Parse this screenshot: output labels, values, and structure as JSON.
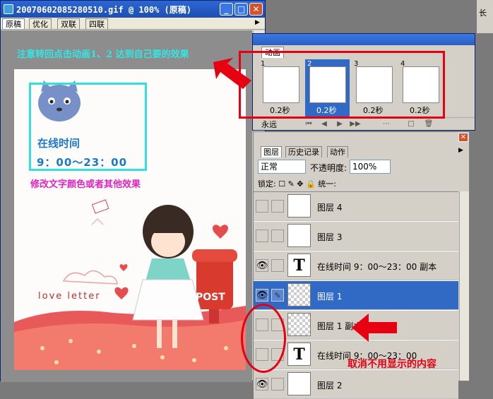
{
  "doc_window": {
    "title": "20070602085280510.gif @ 100% (原稿)",
    "tabs": [
      "原稿",
      "优化",
      "双联",
      "四联"
    ],
    "active_tab": 0
  },
  "image": {
    "online_label": "在线时间",
    "hours": "9：00～23：00",
    "love_letter": "love letter",
    "post": "POST"
  },
  "annotations": {
    "top_note": "注意转回点击动画1、2 达到自己要的效果",
    "modify_note": "修改文字颜色或者其他效果",
    "cancel_note": "取消不用显示的内容",
    "accent_color": "#e60012"
  },
  "animation_panel": {
    "tab": "动画",
    "frames": [
      {
        "num": "1",
        "delay": "0.2秒"
      },
      {
        "num": "2",
        "delay": "0.2秒"
      },
      {
        "num": "3",
        "delay": "0.2秒"
      },
      {
        "num": "4",
        "delay": "0.2秒"
      }
    ],
    "selected_frame": 2,
    "loop": "永远"
  },
  "layers_panel": {
    "tabs": [
      "图层",
      "历史记录",
      "动作"
    ],
    "blend_mode": "正常",
    "opacity_label": "不透明度:",
    "opacity_value": "100%",
    "lock_label": "锁定:",
    "unify_label": "统一:",
    "layers": [
      {
        "name": "图层 4",
        "visible": false,
        "kind": "image"
      },
      {
        "name": "图层 3",
        "visible": false,
        "kind": "image"
      },
      {
        "name": "在线时间 9：00～23：00 副本",
        "visible": true,
        "kind": "text"
      },
      {
        "name": "图层 1",
        "visible": true,
        "kind": "checker",
        "selected": true
      },
      {
        "name": "图层 1 副本",
        "visible": false,
        "kind": "checker"
      },
      {
        "name": "在线时间 9：00～23：00",
        "visible": false,
        "kind": "text"
      },
      {
        "name": "图层 2",
        "visible": true,
        "kind": "image"
      }
    ]
  },
  "right_strip": {
    "text": "长"
  }
}
